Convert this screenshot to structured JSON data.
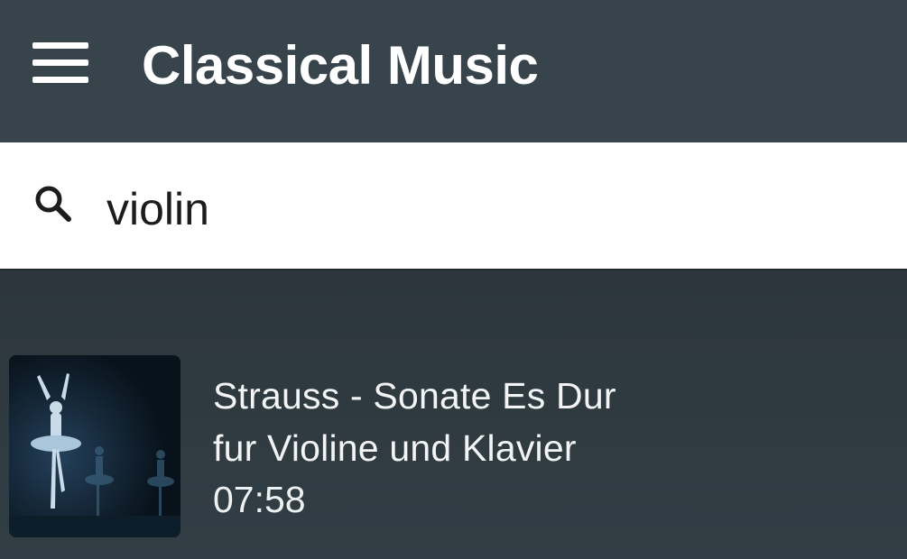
{
  "app_bar": {
    "title": "Classical Music",
    "menu_icon": "hamburger-menu-icon",
    "background": "#38444b"
  },
  "search": {
    "icon": "search-icon",
    "value": "violin"
  },
  "results": [
    {
      "title_line1": "Strauss - Sonate Es Dur",
      "title_line2": "fur Violine und Klavier",
      "duration": "07:58",
      "thumbnail": "ballet-dancer-thumbnail"
    }
  ]
}
